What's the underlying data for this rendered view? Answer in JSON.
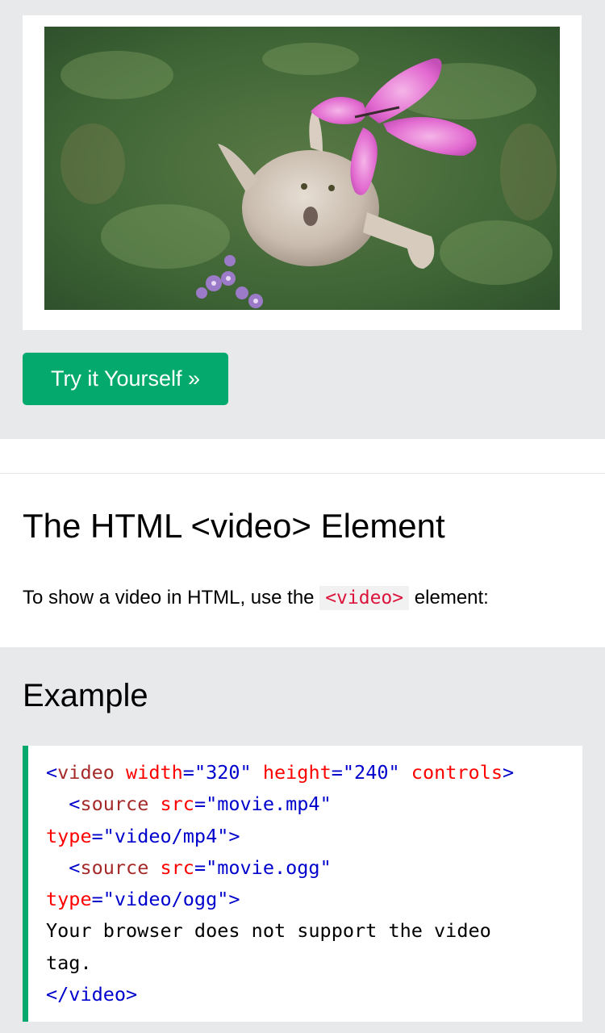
{
  "try_button": {
    "label": "Try it Yourself »"
  },
  "section": {
    "title": "The HTML <video> Element",
    "intro_prefix": "To show a video in HTML, use the ",
    "intro_code": "<video>",
    "intro_suffix": " element:"
  },
  "example": {
    "heading": "Example",
    "code": {
      "l1_open": "<",
      "l1_tag": "video",
      "l1_attr1": " width",
      "l1_eq1": "=",
      "l1_val1": "\"320\"",
      "l1_attr2": " height",
      "l1_eq2": "=",
      "l1_val2": "\"240\"",
      "l1_attr3": " controls",
      "l1_close": ">",
      "l2_indent": "  ",
      "l2_open": "<",
      "l2_tag": "source",
      "l2_attr1": " src",
      "l2_eq1": "=",
      "l2_val1": "\"movie.mp4\"",
      "l3_attr": "type",
      "l3_eq": "=",
      "l3_val": "\"video/mp4\"",
      "l3_close": ">",
      "l4_indent": "  ",
      "l4_open": "<",
      "l4_tag": "source",
      "l4_attr1": " src",
      "l4_eq1": "=",
      "l4_val1": "\"movie.ogg\"",
      "l5_attr": "type",
      "l5_eq": "=",
      "l5_val": "\"video/ogg\"",
      "l5_close": ">",
      "l6_text": "Your browser does not support the video",
      "l7_text": "tag.",
      "l8_tag": "</video>"
    }
  },
  "colors": {
    "accent_green": "#04aa6d",
    "code_tag": "#a52a2a",
    "code_attr": "#ff0000",
    "code_value": "#0000cd",
    "inline_code": "#dc143c",
    "page_gray": "#e7e9eb"
  }
}
